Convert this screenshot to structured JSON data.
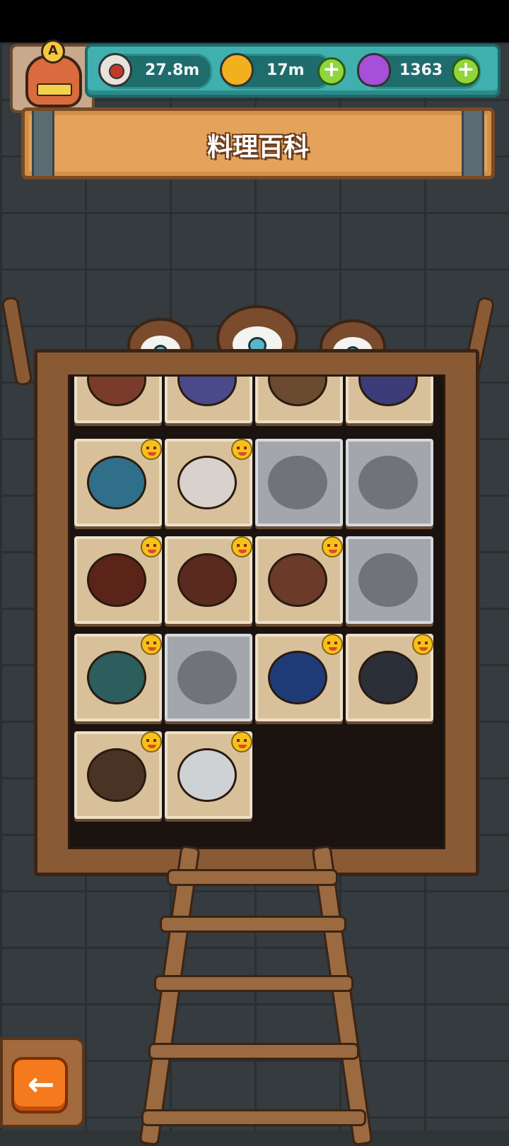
{
  "header": {
    "avatar_badge": "A",
    "resources": [
      {
        "name": "eyeball-currency",
        "value": "27.8m"
      },
      {
        "name": "gold-coin-currency",
        "value": "17m"
      },
      {
        "name": "potion-currency",
        "value": "1363"
      }
    ],
    "title": "料理百科"
  },
  "recipes": [
    {
      "row": 0,
      "col": 0,
      "state": "unlocked",
      "color": "#7a3b2a"
    },
    {
      "row": 0,
      "col": 1,
      "state": "unlocked",
      "color": "#4a4a8a"
    },
    {
      "row": 0,
      "col": 2,
      "state": "unlocked",
      "color": "#6b4b30"
    },
    {
      "row": 0,
      "col": 3,
      "state": "unlocked",
      "color": "#3c3c78"
    },
    {
      "row": 1,
      "col": 0,
      "state": "unlocked",
      "color": "#2f6f8a",
      "badge": true
    },
    {
      "row": 1,
      "col": 1,
      "state": "unlocked",
      "color": "#d9d2cc",
      "badge": true
    },
    {
      "row": 1,
      "col": 2,
      "state": "locked"
    },
    {
      "row": 1,
      "col": 3,
      "state": "locked"
    },
    {
      "row": 2,
      "col": 0,
      "state": "unlocked",
      "color": "#5a2418",
      "badge": true
    },
    {
      "row": 2,
      "col": 1,
      "state": "unlocked",
      "color": "#5a2a1f",
      "badge": true
    },
    {
      "row": 2,
      "col": 2,
      "state": "unlocked",
      "color": "#6b3a28",
      "badge": true
    },
    {
      "row": 2,
      "col": 3,
      "state": "locked"
    },
    {
      "row": 3,
      "col": 0,
      "state": "unlocked",
      "color": "#2b5e5c",
      "badge": true
    },
    {
      "row": 3,
      "col": 1,
      "state": "locked"
    },
    {
      "row": 3,
      "col": 2,
      "state": "unlocked",
      "color": "#1f3b78",
      "badge": true
    },
    {
      "row": 3,
      "col": 3,
      "state": "unlocked",
      "color": "#2a2f38",
      "badge": true
    },
    {
      "row": 4,
      "col": 0,
      "state": "unlocked",
      "color": "#4a3325",
      "badge": true
    },
    {
      "row": 4,
      "col": 1,
      "state": "unlocked",
      "color": "#cfd2d4",
      "badge": true
    }
  ],
  "footer": {
    "back_icon": "←"
  }
}
